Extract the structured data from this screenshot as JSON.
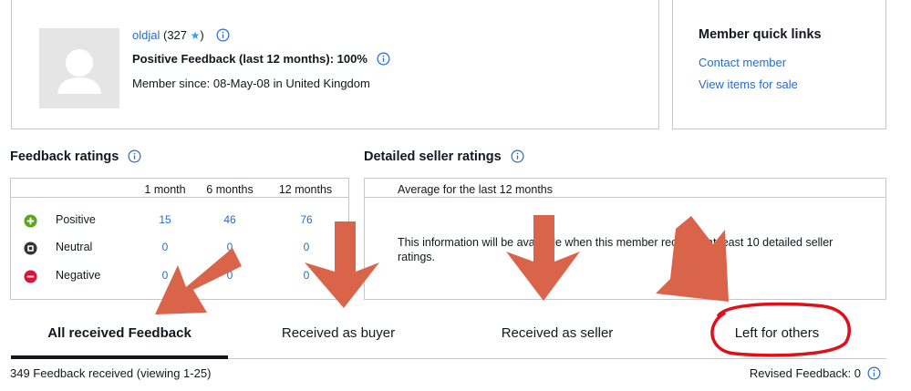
{
  "profile": {
    "username": "oldjal",
    "score_prefix": "(327",
    "score_suffix": ")",
    "positive_feedback": "Positive Feedback (last 12 months): 100%",
    "member_since": "Member since: 08-May-08 in United Kingdom"
  },
  "quick_links": {
    "title": "Member quick links",
    "contact": "Contact member",
    "view_items": "View items for sale"
  },
  "feedback_ratings": {
    "title": "Feedback ratings",
    "columns": [
      "1 month",
      "6 months",
      "12 months"
    ],
    "rows": [
      {
        "label": "Positive",
        "values": [
          "15",
          "46",
          "76"
        ],
        "color": "#5ba71b"
      },
      {
        "label": "Neutral",
        "values": [
          "0",
          "0",
          "0"
        ],
        "color": "#333333"
      },
      {
        "label": "Negative",
        "values": [
          "0",
          "0",
          "0"
        ],
        "color": "#e0103a"
      }
    ]
  },
  "detailed_ratings": {
    "title": "Detailed seller ratings",
    "header": "Average for the last 12 months",
    "message": "This information will be available when this member receives at least 10 detailed seller ratings."
  },
  "tabs": [
    {
      "label": "All received Feedback",
      "active": true
    },
    {
      "label": "Received as buyer",
      "active": false
    },
    {
      "label": "Received as seller",
      "active": false
    },
    {
      "label": "Left for others",
      "active": false
    }
  ],
  "footer": {
    "count": "349 Feedback received (viewing 1-25)",
    "revised": "Revised Feedback: 0"
  },
  "colors": {
    "link": "#2a6cc7",
    "annotation_arrow": "#d9644a",
    "annotation_circle": "#e0101a"
  },
  "icons": [
    "info-icon",
    "star-icon",
    "plus-circle-icon",
    "neutral-circle-icon",
    "minus-circle-icon",
    "user-placeholder-icon"
  ]
}
